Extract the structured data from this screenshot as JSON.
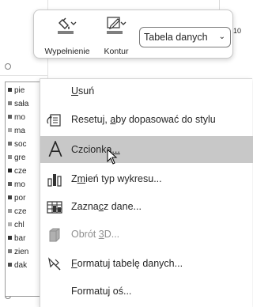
{
  "toolbar": {
    "fill_label": "Wypełnienie",
    "outline_label": "Kontur",
    "element_select_value": "Tabela danych"
  },
  "worksheet": {
    "cell_value": "10",
    "legend_items": [
      {
        "label": "pie",
        "color": "#3a3a3a"
      },
      {
        "label": "sała",
        "color": "#7f7f7f"
      },
      {
        "label": "mo",
        "color": "#5f5f5f"
      },
      {
        "label": "ma",
        "color": "#a6a6a6"
      },
      {
        "label": "soc",
        "color": "#6f6f6f"
      },
      {
        "label": "gre",
        "color": "#8c8c8c"
      },
      {
        "label": "cze",
        "color": "#262626"
      },
      {
        "label": "mo",
        "color": "#595959"
      },
      {
        "label": "por",
        "color": "#404040"
      },
      {
        "label": "cze",
        "color": "#9a9a9a"
      },
      {
        "label": "chl",
        "color": "#b0b0b0"
      },
      {
        "label": "bar",
        "color": "#333333"
      },
      {
        "label": "zien",
        "color": "#7a7a7a"
      },
      {
        "label": "dak",
        "color": "#4d4d4d"
      }
    ]
  },
  "context_menu": {
    "items": [
      {
        "pre": "",
        "key": "U",
        "post": "suń",
        "icon": "none",
        "state": "normal"
      },
      {
        "pre": "Resetuj, ",
        "key": "a",
        "post": "by dopasować do stylu",
        "icon": "reset-style-icon",
        "state": "normal"
      },
      {
        "pre": "Czcionka",
        "key": "...",
        "post": "",
        "icon": "font-icon",
        "state": "highlighted"
      },
      {
        "pre": "Z",
        "key": "m",
        "post": "ień typ wykresu...",
        "icon": "chart-type-icon",
        "state": "normal"
      },
      {
        "pre": "Zazna",
        "key": "c",
        "post": "z dane...",
        "icon": "select-data-icon",
        "state": "normal"
      },
      {
        "pre": "Obrót ",
        "key": "3",
        "post": "D...",
        "icon": "rotation-3d-icon",
        "state": "disabled"
      },
      {
        "pre": "",
        "key": "F",
        "post": "ormatuj tabelę danych...",
        "icon": "format-table-icon",
        "state": "normal"
      },
      {
        "pre": "Formatuj oś...",
        "key": "",
        "post": "",
        "icon": "none",
        "state": "normal"
      }
    ]
  }
}
